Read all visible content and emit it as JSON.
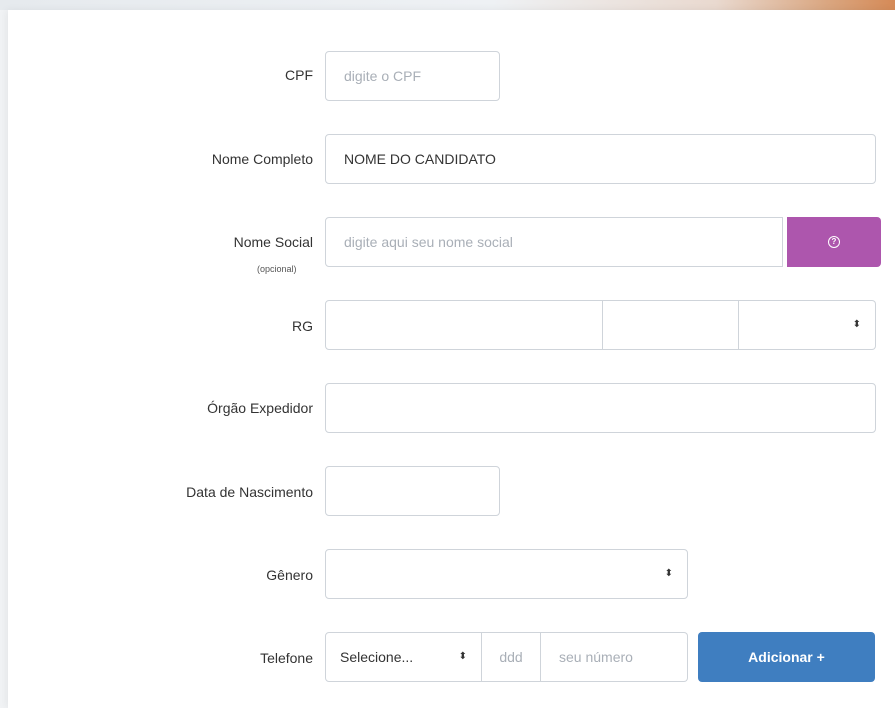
{
  "form": {
    "cpf": {
      "label": "CPF",
      "placeholder": "digite o CPF"
    },
    "nome_completo": {
      "label": "Nome Completo",
      "value": "NOME DO CANDIDATO"
    },
    "nome_social": {
      "label": "Nome Social",
      "sublabel": "(opcional)",
      "placeholder": "digite aqui seu nome social"
    },
    "rg": {
      "label": "RG"
    },
    "orgao_expedidor": {
      "label": "Órgão Expedidor"
    },
    "data_nascimento": {
      "label": "Data de Nascimento"
    },
    "genero": {
      "label": "Gênero"
    },
    "telefone": {
      "label": "Telefone",
      "select_value": "Selecione...",
      "ddd_placeholder": "ddd",
      "numero_placeholder": "seu número",
      "add_button": "Adicionar +"
    }
  },
  "icons": {
    "help": "question-circle-icon",
    "select_caret": "up-down-caret-icon"
  },
  "colors": {
    "help_button": "#ad56ad",
    "add_button": "#3f7ec0",
    "border": "#cfd4da",
    "placeholder": "#a9afb7"
  }
}
